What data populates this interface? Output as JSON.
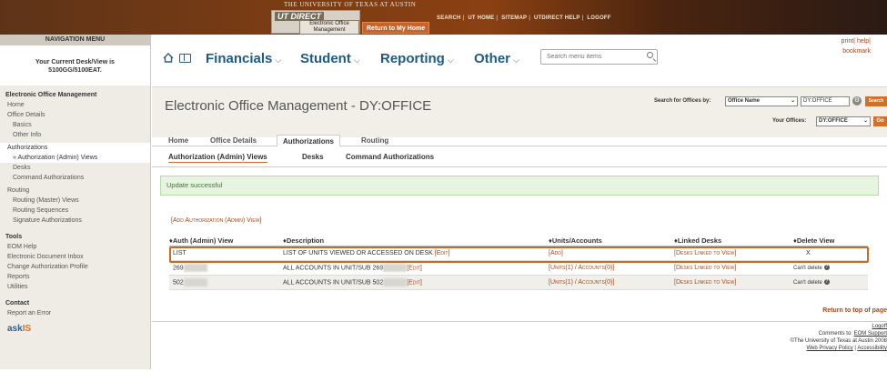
{
  "banner": {
    "university": "THE UNIVERSITY OF TEXAS AT AUSTIN",
    "logo_text": "UT DIRECT",
    "app_name": "Electronic Office Management",
    "return_home": "Return to My Home",
    "links": [
      "SEARCH",
      "UT HOME",
      "SITEMAP",
      "UTDIRECT HELP",
      "LOGOFF"
    ]
  },
  "nav": {
    "header": "NAVIGATION MENU",
    "desk_label": "Your Current Desk/View is",
    "desk_value": "5100GG/5100EAT.",
    "sections": {
      "eom": "Electronic Office Management",
      "home": "Home",
      "office_details": "Office Details",
      "basics": "Basics",
      "other_info": "Other Info",
      "authorizations": "Authorizations",
      "auth_views": "» Authorization (Admin) Views",
      "desks": "Desks",
      "command_auth": "Command Authorizations",
      "routing": "Routing",
      "routing_views": "Routing (Master) Views",
      "routing_seq": "Routing Sequences",
      "signature_auth": "Signature Authorizations",
      "tools": "Tools",
      "eom_help": "EOM Help",
      "doc_inbox": "Electronic Document Inbox",
      "change_profile": "Change Authorization Profile",
      "reports": "Reports",
      "utilities": "Utilities",
      "contact": "Contact",
      "report_error": "Report an Error",
      "askus": "ask"
    }
  },
  "util": {
    "print": "print",
    "help": "help",
    "bookmark": "bookmark"
  },
  "menu": {
    "financials": "Financials",
    "student": "Student",
    "reporting": "Reporting",
    "other": "Other",
    "search_placeholder": "Search menu items"
  },
  "header": {
    "title": "Electronic Office Management - DY:OFFICE",
    "search_label": "Search for Offices by:",
    "search_by": "Office Name",
    "search_value": "DY:OFFICE",
    "search_btn": "Search",
    "your_offices_label": "Your Offices:",
    "your_offices_value": "DY:OFFICE",
    "go": "Go"
  },
  "tabs": {
    "home": "Home",
    "office_details": "Office Details",
    "authorizations": "Authorizations",
    "routing": "Routing",
    "active": "Authorizations"
  },
  "subtabs": {
    "views": "Authorization (Admin) Views",
    "desks": "Desks",
    "command": "Command Authorizations"
  },
  "success": "Update successful",
  "add_link": "[Add Authorization (Admin) View]",
  "table": {
    "headers": [
      "♦Auth (Admin) View",
      "♦Description",
      "♦Units/Accounts",
      "♦Linked Desks",
      "♦Delete View"
    ],
    "rows": [
      {
        "view": "LIST",
        "desc": "LIST OF UNITS VIEWED OR ACCESSED ON DESK",
        "edit": "[Edit]",
        "units": "[Add]",
        "desks": "[Desks Linked to View]",
        "delete": "X"
      },
      {
        "view": "269",
        "desc": "ALL ACCOUNTS IN UNIT/SUB 269",
        "edit": "[Edit]",
        "units": "[Units(1) / Accounts(0)]",
        "desks": "[Desks Linked to View]",
        "delete": "Can't delete"
      },
      {
        "view": "502",
        "desc": "ALL ACCOUNTS IN UNIT/SUB 502",
        "edit": "[Edit]",
        "units": "[Units(1) / Accounts(0)]",
        "desks": "[Desks Linked to View]",
        "delete": "Can't delete"
      }
    ]
  },
  "footer": {
    "return_top": "Return to top of page",
    "logoff": "Logoff",
    "comments": "Comments to:",
    "support": "EOM Support",
    "copyright": "©The University of Texas at Austin 2008",
    "privacy": "Web Privacy Policy",
    "accessibility": "Accessibility"
  }
}
